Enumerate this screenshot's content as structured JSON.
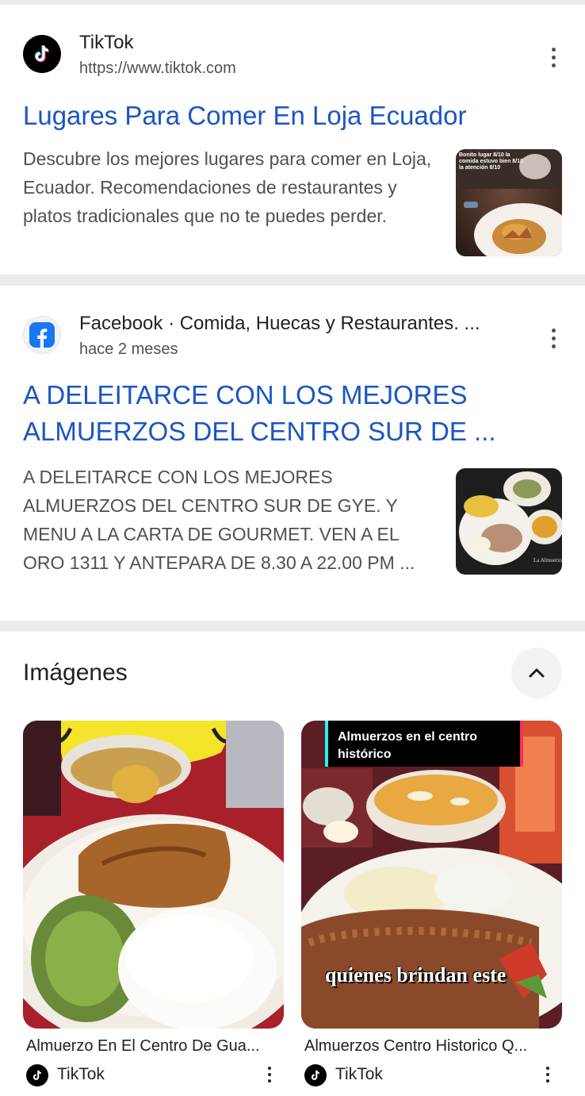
{
  "results": [
    {
      "source_name": "TikTok",
      "source_sub": "https://www.tiktok.com",
      "title": "Lugares Para Comer En Loja Ecuador",
      "snippet": "Descubre los mejores lugares para comer en Loja, Ecuador. Recomendaciones de restaurantes y platos tradicionales que no te puedes perder.",
      "favicon": "tiktok-logo-icon",
      "thumb_overlay": "Bonito lugar 8/10 la comida estuvo bien 8/10 la atención 8/10"
    },
    {
      "source_name": "Facebook · Comida, Huecas y Restaurantes. ...",
      "source_sub": "hace 2 meses",
      "title": "A DELEITARCE CON LOS MEJORES ALMUERZOS DEL CENTRO SUR DE ...",
      "snippet": "A DELEITARCE CON LOS MEJORES ALMUERZOS DEL CENTRO SUR DE GYE. Y MENU A LA CARTA DE GOURMET. VEN A EL ORO 1311 Y ANTEPARA DE 8.30 A 22.00 PM ...",
      "favicon": "facebook-logo-icon"
    }
  ],
  "images_section": {
    "title": "Imágenes",
    "collapse_icon": "chevron-up-icon",
    "items": [
      {
        "caption": "Almuerzo En El Centro De Gua...",
        "source": "TikTok",
        "source_icon": "tiktok-logo-icon"
      },
      {
        "caption": "Almuerzos Centro Historico Q...",
        "source": "TikTok",
        "source_icon": "tiktok-logo-icon",
        "overlay_top": "Almuerzos en el centro histórico",
        "overlay_bottom": "quienes brindan este"
      }
    ]
  },
  "colors": {
    "link": "#1a55c4",
    "divider": "#ebebeb",
    "snippet": "#4d5156"
  }
}
